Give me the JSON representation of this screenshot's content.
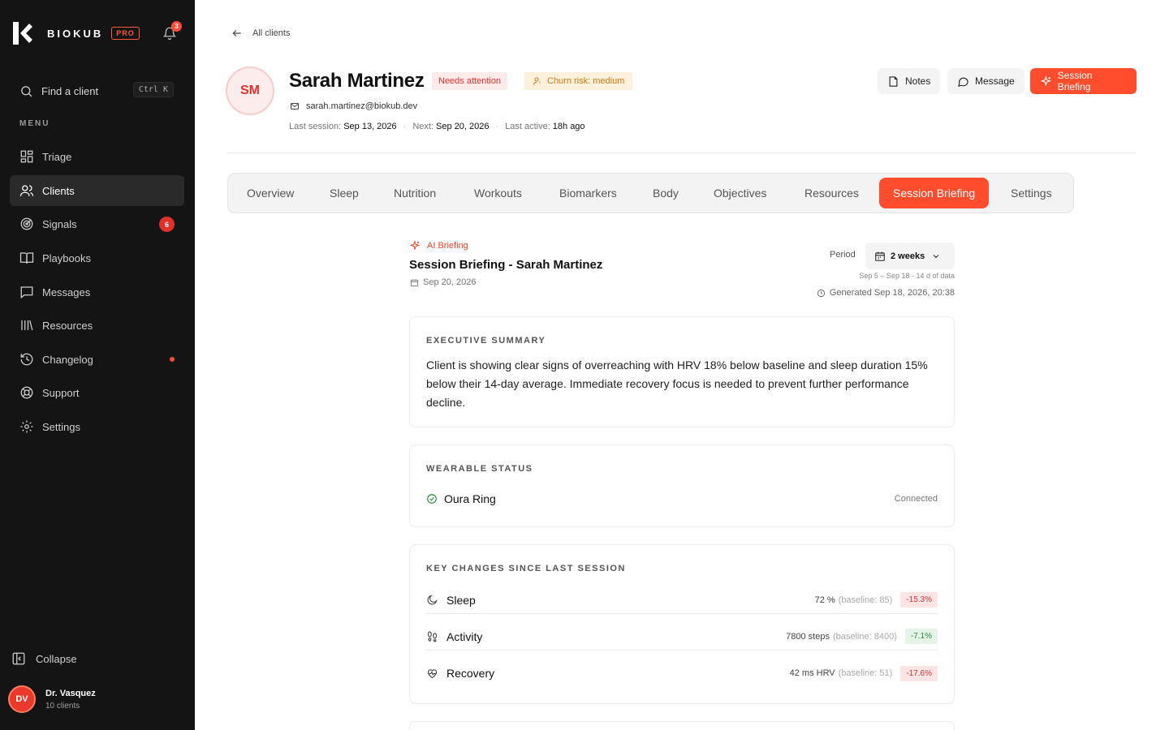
{
  "app": {
    "name": "BIOKUB",
    "plan": "PRO",
    "notifications": "3"
  },
  "search": {
    "label": "Find a client",
    "shortcut": "Ctrl K"
  },
  "menu": {
    "heading": "MENU",
    "items": [
      {
        "label": "Triage"
      },
      {
        "label": "Clients"
      },
      {
        "label": "Signals",
        "badge": "6"
      },
      {
        "label": "Playbooks"
      },
      {
        "label": "Messages"
      },
      {
        "label": "Resources"
      },
      {
        "label": "Changelog"
      },
      {
        "label": "Support"
      },
      {
        "label": "Settings"
      }
    ]
  },
  "collapse_label": "Collapse",
  "user": {
    "initials": "DV",
    "name": "Dr. Vasquez",
    "sub": "10 clients"
  },
  "back_label": "All clients",
  "client": {
    "initials": "SM",
    "name": "Sarah Martinez",
    "status_tag": "Needs attention",
    "churn_tag": "Churn risk: medium",
    "email": "sarah.martinez@biokub.dev",
    "last_session_label": "Last session:",
    "last_session": "Sep 13, 2026",
    "next_label": "Next:",
    "next": "Sep 20, 2026",
    "last_active_label": "Last active:",
    "last_active": "18h ago"
  },
  "actions": {
    "notes": "Notes",
    "message": "Message",
    "briefing": "Session Briefing"
  },
  "tabs": [
    "Overview",
    "Sleep",
    "Nutrition",
    "Workouts",
    "Biomarkers",
    "Body",
    "Objectives",
    "Resources",
    "Session Briefing",
    "Settings"
  ],
  "briefing": {
    "ai_label": "AI Briefing",
    "title": "Session Briefing - Sarah Martinez",
    "date": "Sep 20, 2026",
    "period_label": "Period",
    "period_value": "2 weeks",
    "period_range": "Sep 5 – Sep 18 · 14 d of data",
    "generated": "Generated Sep 18, 2026, 20:38"
  },
  "summary": {
    "heading": "EXECUTIVE SUMMARY",
    "text": "Client is showing clear signs of overreaching with HRV 18% below baseline and sleep duration 15% below their 14-day average. Immediate recovery focus is needed to prevent further performance decline."
  },
  "wearable": {
    "heading": "WEARABLE STATUS",
    "device": "Oura Ring",
    "status": "Connected"
  },
  "changes": {
    "heading": "KEY CHANGES SINCE LAST SESSION",
    "rows": [
      {
        "name": "Sleep",
        "value": "72 %",
        "baseline": "(baseline: 85)",
        "delta": "-15.3%"
      },
      {
        "name": "Activity",
        "value": "7800 steps",
        "baseline": "(baseline: 8400)",
        "delta": "-7.1%"
      },
      {
        "name": "Recovery",
        "value": "42 ms HRV",
        "baseline": "(baseline: 51)",
        "delta": "-17.6%"
      }
    ]
  }
}
